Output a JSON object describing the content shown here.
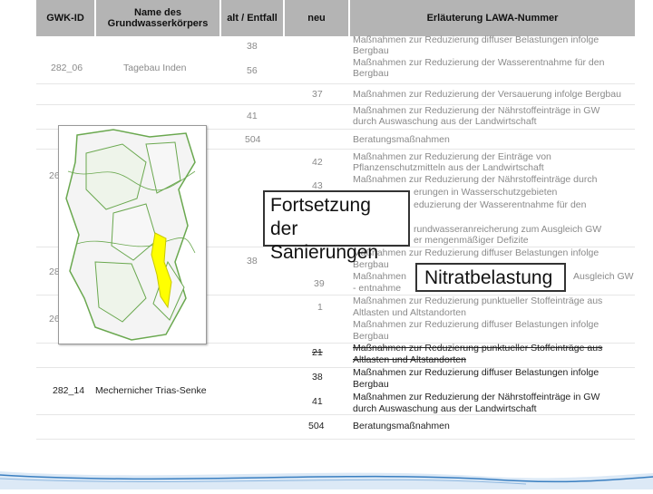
{
  "header": {
    "gwk_id": "GWK-ID",
    "name": "Name des Grundwasserkörpers",
    "alt": "alt / Entfall",
    "neu": "neu",
    "erlaeuterung": "Erläuterung LAWA-Nummer"
  },
  "rows": [
    {
      "gwk": "282_06",
      "name": "Tagebau Inden"
    },
    {
      "gwk": "26",
      "name": ""
    },
    {
      "gwk": "28",
      "name": ""
    },
    {
      "gwk": "26",
      "name": ""
    },
    {
      "gwk": "282_14",
      "name": "Mechernicher Trias-Senke"
    }
  ],
  "alt_values": [
    "38",
    "56",
    "41",
    "504",
    "38"
  ],
  "neu_values": [
    "37",
    "42",
    "43",
    "39",
    "1",
    "21",
    "38",
    "41",
    "504"
  ],
  "descriptions": [
    "Maßnahmen zur Reduzierung diffuser Belastungen infolge",
    "Bergbau",
    "Maßnahmen zur Reduzierung der Wasserentnahme für den",
    "Bergbau",
    "Maßnahmen zur Reduzierung der Versauerung infolge Bergbau",
    "Maßnahmen zur Reduzierung der  Nährstoffeinträge in GW",
    "durch Auswaschung aus der Landwirtschaft",
    "Beratungsmaßnahmen",
    "Maßnahmen zur Reduzierung der Einträge von",
    "Pflanzenschutzmitteln aus der Landwirtschaft",
    "Maßnahmen zur Reduzierung der Nährstoffeinträge durch",
    "erungen  in Wasserschutzgebieten",
    "eduzierung der Wasserentnahme für den",
    "rundwasseranreicherung zum Ausgleich GW",
    "er mengenmäßiger Defizite",
    "Maßnahmen zur Reduzierung diffuser Belastungen infolge",
    "Bergbau",
    "Maßnahmen",
    "Ausgleich GW",
    "- entnahme",
    "Maßnahmen zur Reduzierung punktueller Stoffeinträge aus",
    "Altlasten und Altstandorten",
    "Maßnahmen zur Reduzierung diffuser Belastungen infolge",
    "Bergbau",
    "Maßnahmen zur Reduzierung punktueller Stoffeinträge aus",
    "Altlasten und Altstandorten",
    "Maßnahmen zur Reduzierung diffuser Belastungen infolge",
    "Bergbau",
    "Maßnahmen zur Reduzierung der  Nährstoffeinträge in GW",
    "durch Auswaschung aus der Landwirtschaft",
    "Beratungsmaßnahmen"
  ],
  "callouts": {
    "sanierung_line1": "Fortsetzung der",
    "sanierung_line2": "Sanierungen",
    "nitrat": "Nitratbelastung"
  },
  "colors": {
    "header_bg": "#b4b4b4",
    "map_green": "#6aa84f",
    "map_yellow": "#ffff00",
    "footer_blue": "#3a7fc1"
  }
}
